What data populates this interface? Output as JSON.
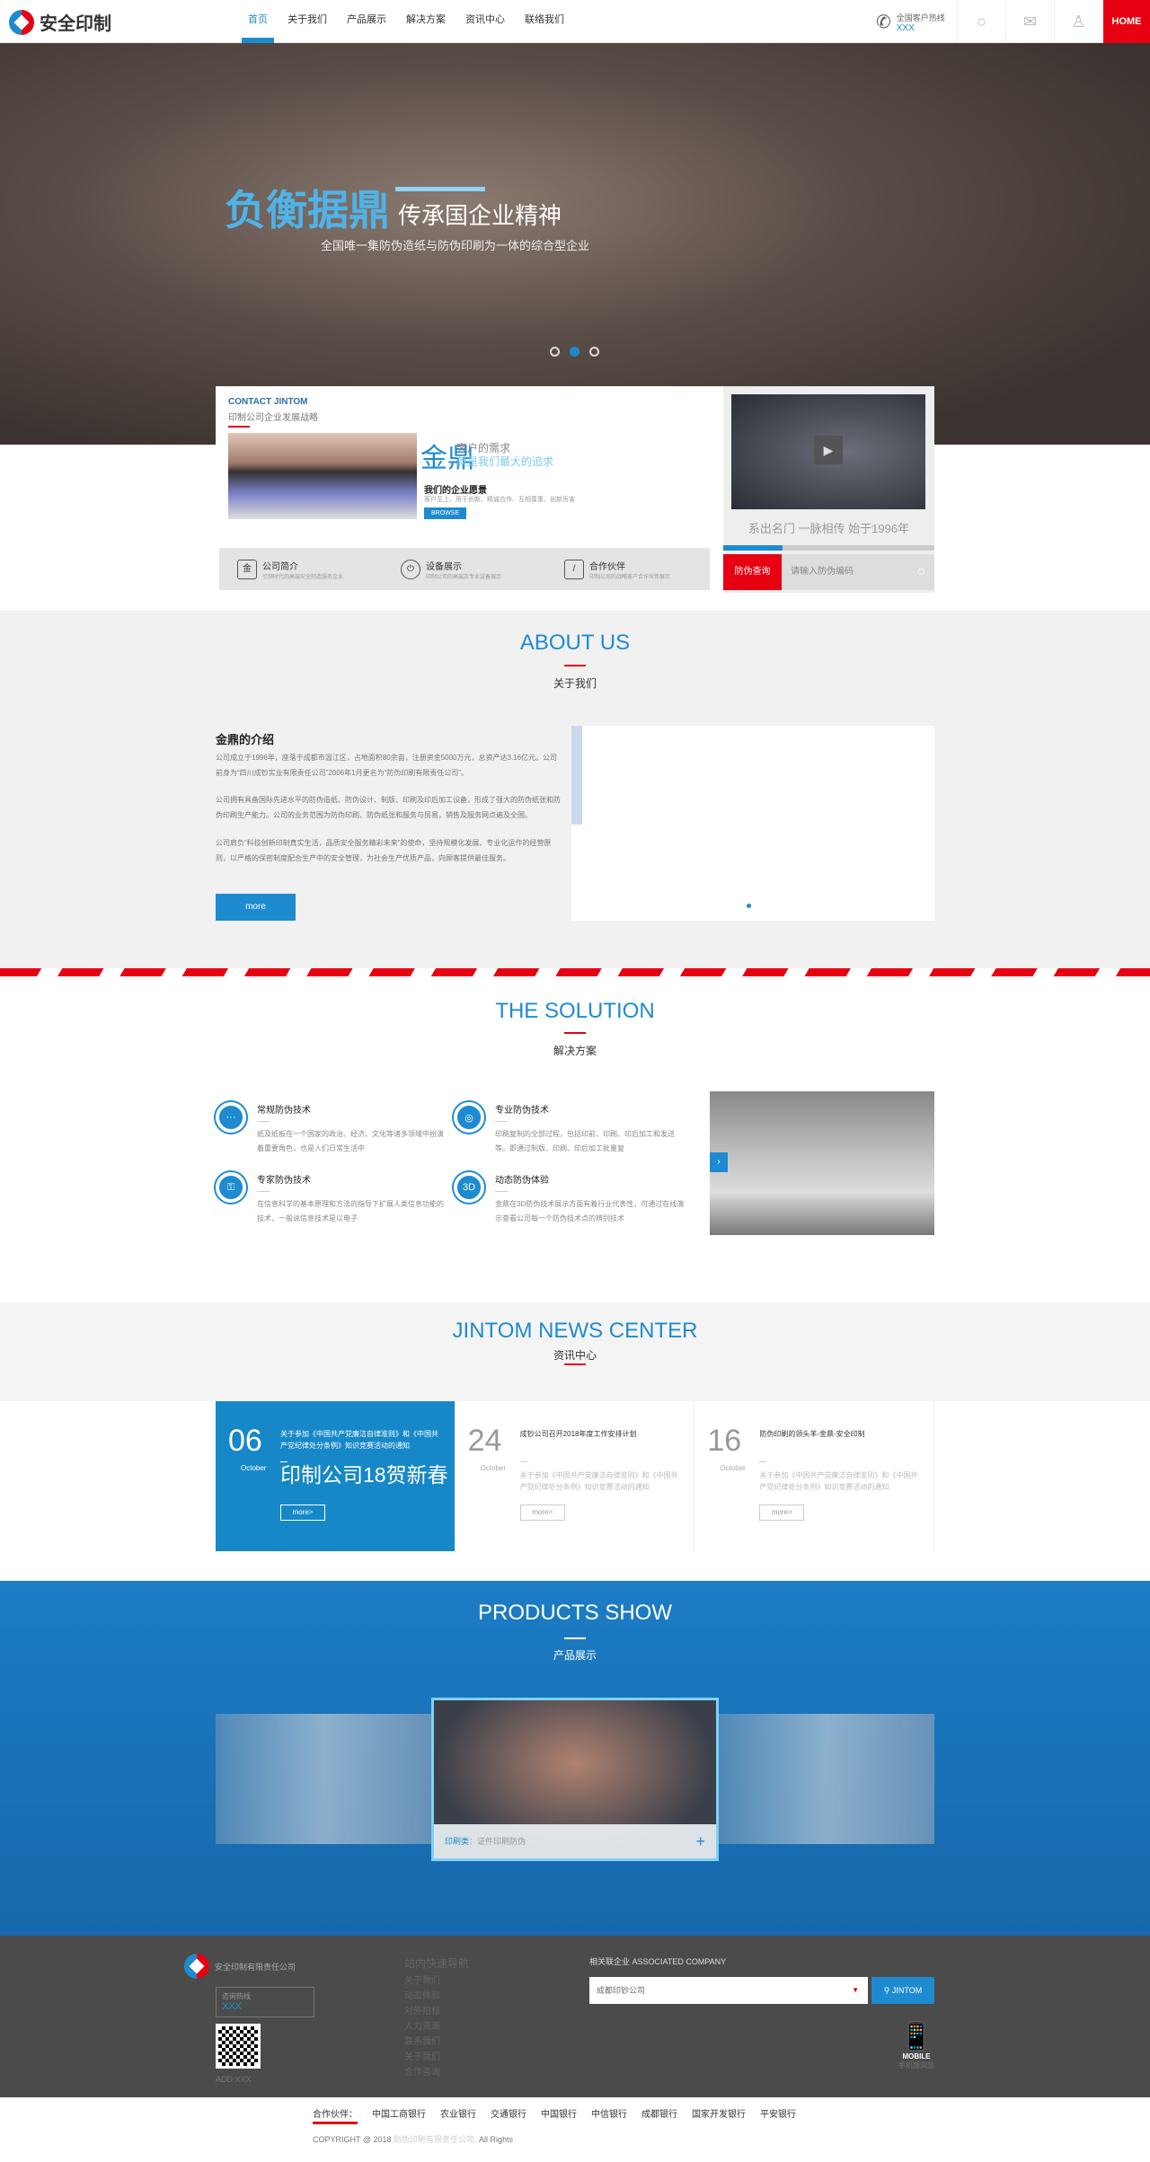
{
  "header": {
    "logo_text": "安全印制",
    "nav": [
      "首页",
      "关于我们",
      "产品展示",
      "解决方案",
      "资讯中心",
      "联络我们"
    ],
    "active_nav": 0,
    "hotline_label": "全国客户热线",
    "hotline_number": "XXX",
    "home_label": "HOME"
  },
  "hero": {
    "title": "负衡据鼎",
    "subtitle": "传承国企业精神",
    "description": "全国唯一集防伪造纸与防伪印刷为一体的综合型企业",
    "slides": 3,
    "active_slide": 2
  },
  "contact_card": {
    "title": "CONTACT JINTOM",
    "subtitle": "印制公司企业发展战略",
    "calligraphy": "金鼎",
    "need_line1": "客户的需求",
    "need_line2": "就是我们最大的追求",
    "vision_title": "我们的企业愿景",
    "vision_desc": "客户至上、用于创新、精诚合作、互相尊重、创新厉害",
    "browse_label": "BROWSE",
    "features": [
      {
        "icon": "金",
        "title": "公司简介",
        "desc": "引领时代的高端安全制造服务企业"
      },
      {
        "icon": "⏻",
        "title": "设备展示",
        "desc": "印制公司的高端及专业设备展示"
      },
      {
        "icon": "/",
        "title": "合作伙伴",
        "desc": "印制公司的战略客户合作伙伴展示"
      }
    ]
  },
  "video_card": {
    "caption": "系出名门 一脉相传 始于1996年",
    "progress": 0.28,
    "query_label": "防伪查询",
    "query_placeholder": "请输入防伪编码"
  },
  "about": {
    "title": "ABOUT US",
    "subtitle": "关于我们",
    "heading": "金鼎的介绍",
    "paragraphs": [
      "公司成立于1996年，座落于成都市温江区，占地面积80余亩，注册资金5000万元，总资产达3.16亿元。公司前身为“四川成钞实业有限责任公司”2006年1月更名为“防伪印刷有限责任公司”。",
      "公司拥有具备国际先进水平的防伪造纸、防伪设计、制版、印刷及印后加工设备，形成了强大的防伪纸张和防伪印刷生产能力。公司的业务范围为防伪印刷、防伪纸张和服务与贸易，销售及服务网点遍及全国。",
      "公司肩负“科技创新印制真实生活，品质安全服务精彩未来”的使命，坚持规模化发展、专业化运作的经营原则，以严格的保密制度配合生产中的安全管理，为社会生产优质产品，向顾客提供最佳服务。"
    ],
    "more_label": "more"
  },
  "solution": {
    "title": "THE SOLUTION",
    "subtitle": "解决方案",
    "items": [
      {
        "icon": "···",
        "title": "常规防伪技术",
        "desc": "纸及纸板在一个国家的政治、经济、文化等诸多领域中扮演着重要角色，也是人们日常生活中"
      },
      {
        "icon": "◎",
        "title": "专业防伪技术",
        "desc": "印刷复制的全部过程，包括印前、印刷、印后加工和发送等。即通过制版、印刷、印后加工批量复"
      },
      {
        "icon": "⚿",
        "title": "专家防伪技术",
        "desc": "在信息科学的基本原理和方法的指导下扩展人类信息功能的技术，一般说信息技术是以电子"
      },
      {
        "icon": "3D",
        "title": "动态防伪体验",
        "desc": "金鼎在3D防伪技术展示方面有着行业代表性，可通过在线演示查看公司每一个防伪技术点的辨别技术"
      }
    ],
    "image_arrow": "›"
  },
  "news": {
    "title": "JINTOM NEWS CENTER",
    "subtitle": "资讯中心",
    "items": [
      {
        "day": "06",
        "month": "October",
        "title": "关于参加《中国共产党廉洁自律准则》和《中国共产党纪律处分条例》知识竞赛活动的通知",
        "headline": "印制公司18贺新春",
        "more": "more>"
      },
      {
        "day": "24",
        "month": "October",
        "title": "成钞公司召开2018年度工作安排计划",
        "desc": "关于参加《中国共产党廉洁自律准则》和《中国共产党纪律处分条例》知识竞赛活动的通知",
        "more": "more>"
      },
      {
        "day": "16",
        "month": "October",
        "title": "防伪印刷的领头羊-金鼎-安全印制",
        "desc": "关于参加《中国共产党廉洁自律准则》和《中国共产党纪律处分条例》知识竞赛活动的通知",
        "more": "more>"
      }
    ]
  },
  "products": {
    "title": "PRODUCTS SHOW",
    "subtitle": "产品展示",
    "caption_category": "印刷类",
    "caption_text": "：证件印刷防伪",
    "plus": "+"
  },
  "footer": {
    "company": "安全印制有限责任公司",
    "hotline_label": "咨询热线",
    "hotline_number": "XXX",
    "address": "ADD:XXX",
    "nav_title": "站内快速导航",
    "nav_links": [
      "关于我们",
      "动态体验",
      "对外招标",
      "人力资源",
      "联系我们",
      "关于我们",
      "合作咨询"
    ],
    "associated_title": "相关联企业 ASSOCIATED COMPANY",
    "associated_selected": "成都印钞公司",
    "go_label": "JINTOM",
    "mobile_label": "MOBILE",
    "mobile_sub": "手机版浏览"
  },
  "bottom": {
    "partners_label": "合作伙伴：",
    "partners": [
      "中国工商银行",
      "农业银行",
      "交通银行",
      "中国银行",
      "中信银行",
      "成都银行",
      "国家开发银行",
      "平安银行"
    ],
    "copyright": "COPYRIGHT @ 2018",
    "company": "防伪印刷有限责任公司.",
    "rights": "All Rights"
  }
}
